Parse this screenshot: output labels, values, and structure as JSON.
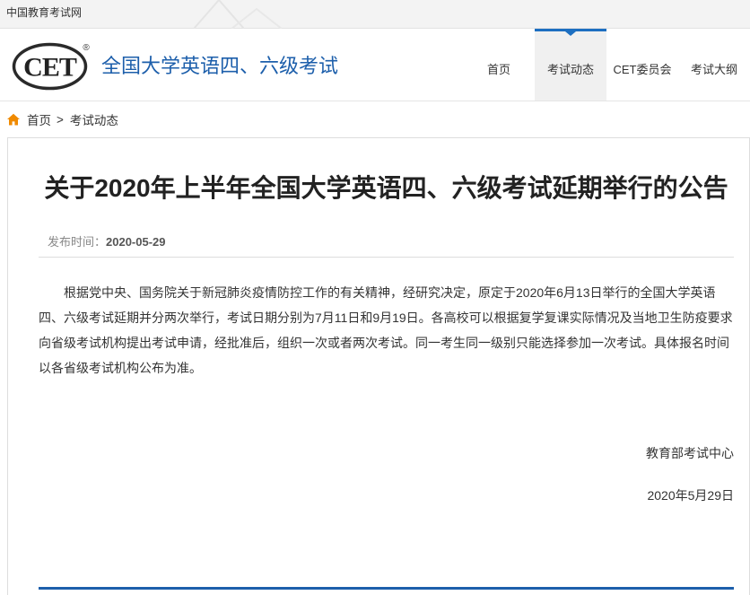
{
  "topbar": {
    "site_name": "中国教育考试网"
  },
  "header": {
    "logo_text": "CET",
    "logo_mark": "®",
    "title": "全国大学英语四、六级考试",
    "nav": [
      {
        "label": "首页",
        "active": false
      },
      {
        "label": "考试动态",
        "active": true
      },
      {
        "label": "CET委员会",
        "active": false
      },
      {
        "label": "考试大纲",
        "active": false
      }
    ]
  },
  "breadcrumb": {
    "icon": "home-icon",
    "home": "首页",
    "separator": ">",
    "current": "考试动态"
  },
  "article": {
    "title": "关于2020年上半年全国大学英语四、六级考试延期举行的公告",
    "publish_label": "发布时间：",
    "publish_date": "2020-05-29",
    "body": "根据党中央、国务院关于新冠肺炎疫情防控工作的有关精神，经研究决定，原定于2020年6月13日举行的全国大学英语四、六级考试延期并分两次举行，考试日期分别为7月11日和9月19日。各高校可以根据复学复课实际情况及当地卫生防疫要求向省级考试机构提出考试申请，经批准后，组织一次或者两次考试。同一考生同一级别只能选择参加一次考试。具体报名时间以各省级考试机构公布为准。",
    "signature_org": "教育部考试中心",
    "signature_date": "2020年5月29日"
  },
  "colors": {
    "brand_blue": "#1d5fab",
    "nav_active_accent": "#1d6fc1",
    "home_icon": "#f08a00"
  }
}
